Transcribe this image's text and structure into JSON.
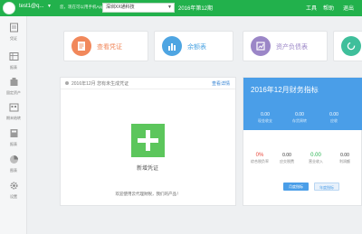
{
  "topbar": {
    "user_name": "test1@q...",
    "notice": "您，现在可以用手机App来记账哦，快来下载试试吧！",
    "company": "深圳XX通科技",
    "period": "2016年第12期",
    "links": [
      "工具",
      "帮助",
      "退出"
    ]
  },
  "sidebar": {
    "items": [
      {
        "label": "凭证",
        "icon": "voucher-icon"
      },
      {
        "label": "报表",
        "icon": "ledger-icon"
      },
      {
        "label": "固定资产",
        "icon": "fixed-assets-icon"
      },
      {
        "label": "期末结转",
        "icon": "period-end-icon"
      },
      {
        "label": "报表",
        "icon": "report-icon"
      },
      {
        "label": "图表",
        "icon": "pie-chart-icon"
      },
      {
        "label": "设置",
        "icon": "gear-icon"
      }
    ]
  },
  "cards": [
    {
      "label": "查看凭证",
      "icon": "document-icon",
      "color": "#f1885b"
    },
    {
      "label": "余额表",
      "icon": "bar-chart-icon",
      "color": "#4ea5e2"
    },
    {
      "label": "资产负债表",
      "icon": "balance-sheet-icon",
      "color": "#9b86c7"
    }
  ],
  "voucher": {
    "title": "2016年12月 您有未生成凭证",
    "detail_link": "查看详情",
    "new_label": "新增凭证",
    "welcome": "欢迎使用云代理财税，我们的产品！"
  },
  "finance": {
    "title": "2016年12月财务指标",
    "top_metrics": [
      {
        "value": "0.00",
        "label": "现金收支"
      },
      {
        "value": "0.00",
        "label": "存货周转"
      },
      {
        "value": "0.00",
        "label": "应收"
      }
    ],
    "bottom_metrics": [
      {
        "value": "0%",
        "label": "综合税负率"
      },
      {
        "value": "0.00",
        "label": "应交税费"
      },
      {
        "value": "0.00",
        "label": "营业收入"
      },
      {
        "value": "0.00",
        "label": "利润额"
      }
    ],
    "buttons": [
      "月度指标",
      "年度指标"
    ],
    "colors": {
      "header": "#4a9ee8",
      "accent": "#e8463a",
      "green": "#22b14c"
    }
  }
}
